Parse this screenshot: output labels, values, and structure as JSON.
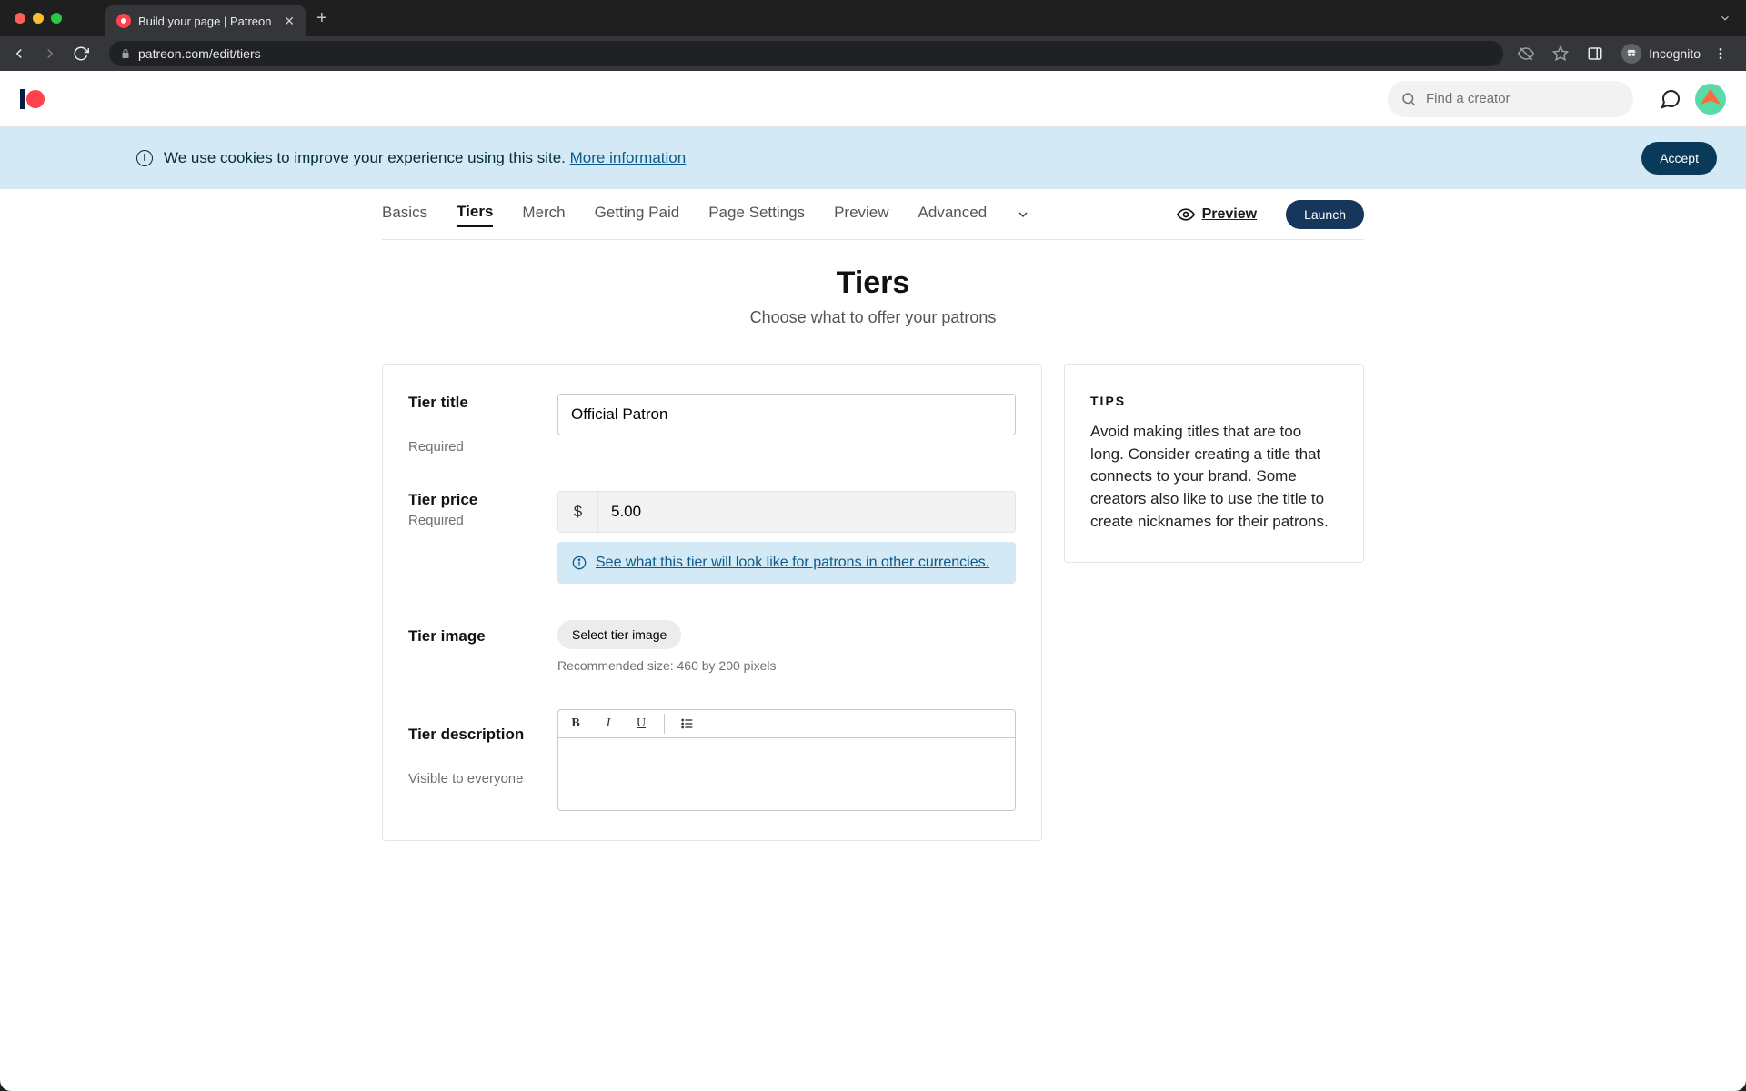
{
  "browser": {
    "tab_title": "Build your page | Patreon",
    "url": "patreon.com/edit/tiers",
    "incognito_label": "Incognito"
  },
  "topnav": {
    "search_placeholder": "Find a creator"
  },
  "cookie": {
    "text": "We use cookies to improve your experience using this site.",
    "link": "More information",
    "accept": "Accept"
  },
  "subnav": {
    "tabs": [
      "Basics",
      "Tiers",
      "Merch",
      "Getting Paid",
      "Page Settings",
      "Preview",
      "Advanced"
    ],
    "active_index": 1,
    "preview": "Preview",
    "launch": "Launch"
  },
  "page": {
    "title": "Tiers",
    "subtitle": "Choose what to offer your patrons"
  },
  "form": {
    "title_label": "Tier title",
    "title_required": "Required",
    "title_value": "Official Patron",
    "price_label": "Tier price",
    "price_required": "Required",
    "currency_symbol": "$",
    "price_value": "5.00",
    "currency_info": "See what this tier will look like for patrons in other currencies.",
    "image_label": "Tier image",
    "image_button": "Select tier image",
    "image_hint": "Recommended size: 460 by 200 pixels",
    "desc_label": "Tier description",
    "desc_hint": "Visible to everyone"
  },
  "tips": {
    "heading": "TIPS",
    "body": "Avoid making titles that are too long. Consider creating a title that connects to your brand. Some creators also like to use the title to create nicknames for their patrons."
  }
}
